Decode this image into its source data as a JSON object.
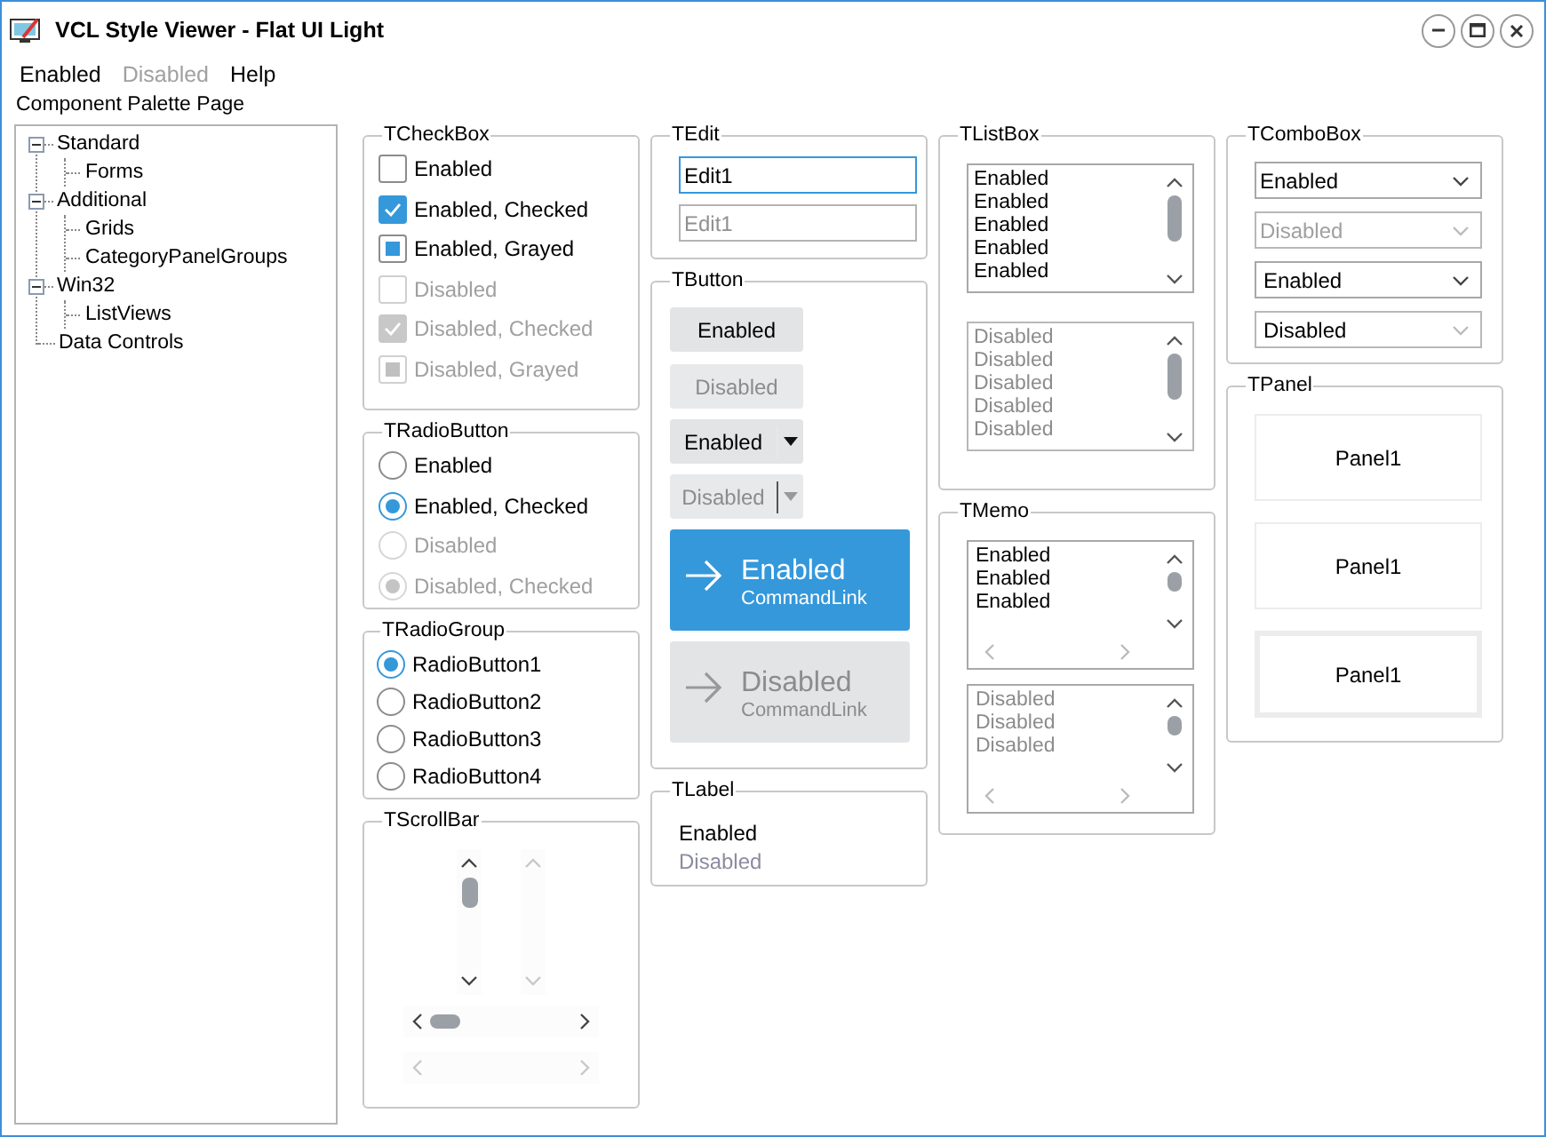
{
  "window": {
    "title": "VCL Style Viewer - Flat UI Light"
  },
  "menu": [
    {
      "label": "Enabled",
      "disabled": false
    },
    {
      "label": "Disabled",
      "disabled": true
    },
    {
      "label": "Help",
      "disabled": false
    }
  ],
  "palette_label": "Component Palette Page",
  "tree": [
    {
      "label": "Standard",
      "expanded": true,
      "children": [
        {
          "label": "Forms"
        }
      ]
    },
    {
      "label": "Additional",
      "expanded": true,
      "children": [
        {
          "label": "Grids"
        },
        {
          "label": "CategoryPanelGroups"
        }
      ]
    },
    {
      "label": "Win32",
      "expanded": true,
      "children": [
        {
          "label": "ListViews"
        }
      ]
    },
    {
      "label": "Data Controls"
    }
  ],
  "checkboxes": {
    "title": "TCheckBox",
    "items": [
      {
        "label": "Enabled",
        "checked": false,
        "grayed": false,
        "disabled": false
      },
      {
        "label": "Enabled, Checked",
        "checked": true,
        "grayed": false,
        "disabled": false
      },
      {
        "label": "Enabled, Grayed",
        "checked": false,
        "grayed": true,
        "disabled": false
      },
      {
        "label": "Disabled",
        "checked": false,
        "grayed": false,
        "disabled": true
      },
      {
        "label": "Disabled, Checked",
        "checked": true,
        "grayed": false,
        "disabled": true
      },
      {
        "label": "Disabled, Grayed",
        "checked": false,
        "grayed": true,
        "disabled": true
      }
    ]
  },
  "radio_buttons": {
    "title": "TRadioButton",
    "items": [
      {
        "label": "Enabled",
        "checked": false,
        "disabled": false
      },
      {
        "label": "Enabled, Checked",
        "checked": true,
        "disabled": false
      },
      {
        "label": "Disabled",
        "checked": false,
        "disabled": true
      },
      {
        "label": "Disabled, Checked",
        "checked": true,
        "disabled": true
      }
    ]
  },
  "radio_group": {
    "title": "TRadioGroup",
    "items": [
      {
        "label": "RadioButton1",
        "selected": true
      },
      {
        "label": "RadioButton2",
        "selected": false
      },
      {
        "label": "RadioButton3",
        "selected": false
      },
      {
        "label": "RadioButton4",
        "selected": false
      }
    ]
  },
  "scroll_bars": {
    "title": "TScrollBar",
    "vertical": [
      {
        "disabled": false
      },
      {
        "disabled": true
      }
    ],
    "horizontal": [
      {
        "disabled": false
      },
      {
        "disabled": true
      }
    ]
  },
  "edit": {
    "title": "TEdit",
    "fields": [
      {
        "value": "Edit1",
        "disabled": false
      },
      {
        "value": "Edit1",
        "disabled": true
      }
    ]
  },
  "buttons": {
    "title": "TButton",
    "items": [
      {
        "kind": "push",
        "label": "Enabled",
        "disabled": false
      },
      {
        "kind": "push",
        "label": "Disabled",
        "disabled": true
      },
      {
        "kind": "split",
        "label": "Enabled",
        "disabled": false
      },
      {
        "kind": "split",
        "label": "Disabled",
        "disabled": true
      },
      {
        "kind": "command_link",
        "label": "Enabled",
        "note": "CommandLink",
        "disabled": false
      },
      {
        "kind": "command_link",
        "label": "Disabled",
        "note": "CommandLink",
        "disabled": true
      }
    ]
  },
  "label": {
    "title": "TLabel",
    "items": [
      {
        "text": "Enabled",
        "disabled": false
      },
      {
        "text": "Disabled",
        "disabled": true
      }
    ]
  },
  "list_boxes": {
    "title": "TListBox",
    "boxes": [
      {
        "disabled": false,
        "items": [
          "Enabled",
          "Enabled",
          "Enabled",
          "Enabled",
          "Enabled"
        ]
      },
      {
        "disabled": true,
        "items": [
          "Disabled",
          "Disabled",
          "Disabled",
          "Disabled",
          "Disabled"
        ]
      }
    ]
  },
  "memos": {
    "title": "TMemo",
    "boxes": [
      {
        "disabled": false,
        "lines": [
          "Enabled",
          "Enabled",
          "Enabled"
        ]
      },
      {
        "disabled": true,
        "lines": [
          "Disabled",
          "Disabled",
          "Disabled"
        ]
      }
    ]
  },
  "combo_boxes": {
    "title": "TComboBox",
    "items": [
      {
        "kind": "dropdown",
        "value": "Enabled",
        "disabled": false
      },
      {
        "kind": "dropdown",
        "value": "Disabled",
        "disabled": true
      },
      {
        "kind": "list",
        "value": "Enabled",
        "disabled": false
      },
      {
        "kind": "list",
        "value": "Disabled",
        "disabled": true
      }
    ]
  },
  "panels": {
    "title": "TPanel",
    "items": [
      {
        "caption": "Panel1",
        "kind": "single"
      },
      {
        "caption": "Panel1",
        "kind": "single"
      },
      {
        "caption": "Panel1",
        "kind": "double"
      }
    ]
  }
}
